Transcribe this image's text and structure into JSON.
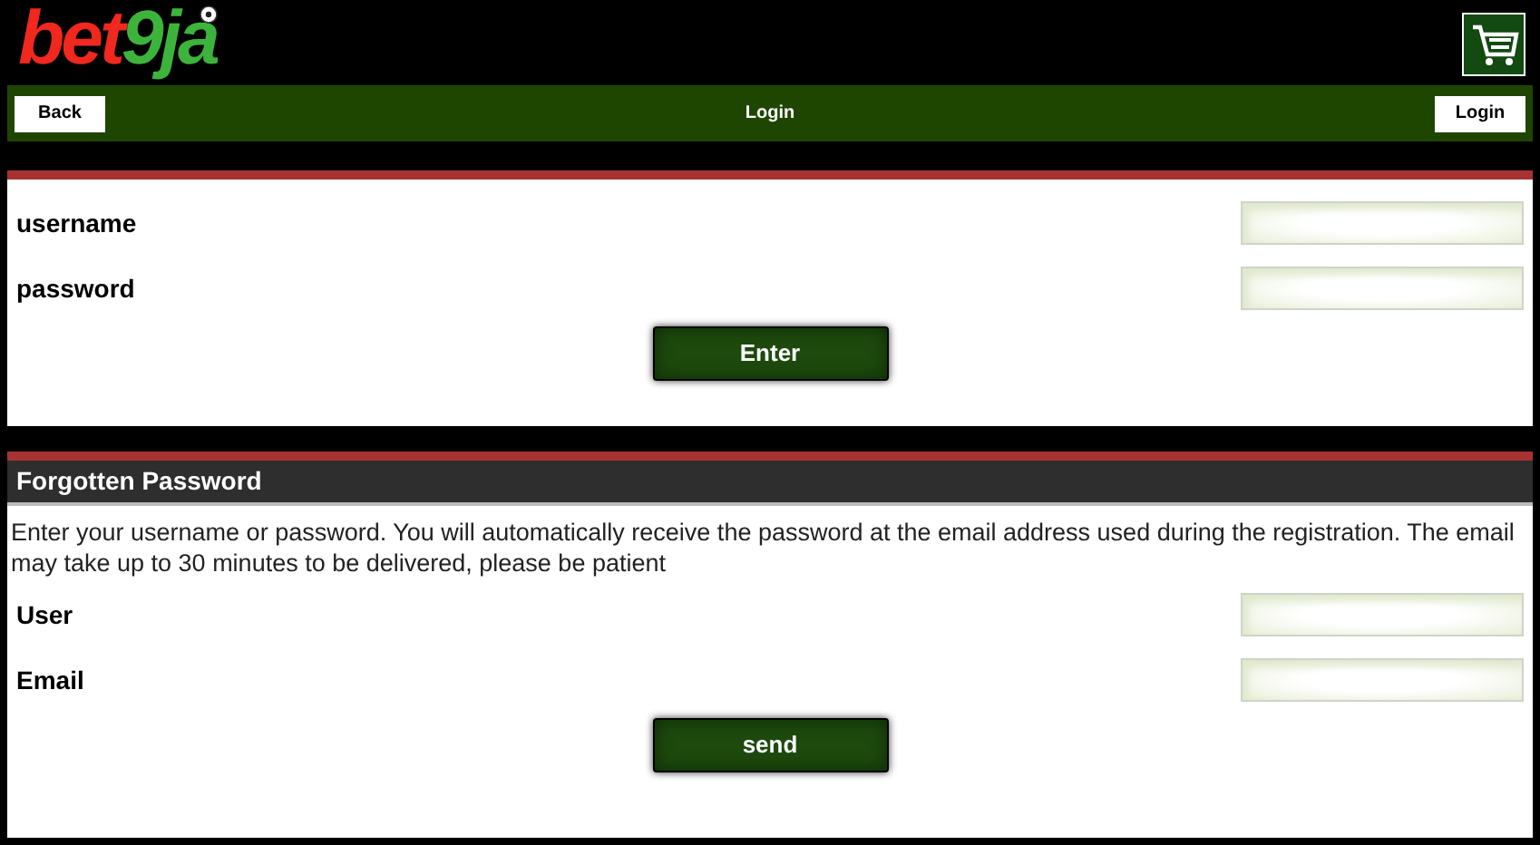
{
  "header": {
    "logo": {
      "part_1": "bet",
      "part_2": "9ja"
    }
  },
  "nav_bar": {
    "back_button": "Back",
    "title": "Login",
    "login_button": "Login"
  },
  "login_form": {
    "fields": [
      {
        "label": "username"
      },
      {
        "label": "password"
      }
    ],
    "submit_button": "Enter"
  },
  "forgotten_password": {
    "title": "Forgotten Password",
    "description": "Enter your username or password. You will automatically receive the password at the email address used during the registration. The email may take up to 30 minutes to be delivered, please be patient",
    "fields": [
      {
        "label": "User"
      },
      {
        "label": "Email"
      }
    ],
    "submit_button": "send"
  }
}
